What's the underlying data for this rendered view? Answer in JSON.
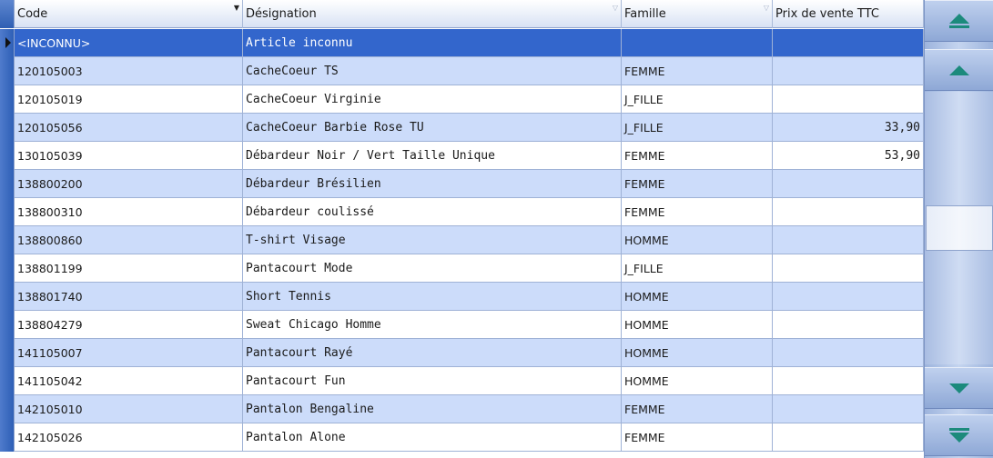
{
  "columns": [
    {
      "label": "Code",
      "key": "code"
    },
    {
      "label": "Désignation",
      "key": "designation"
    },
    {
      "label": "Famille",
      "key": "famille"
    },
    {
      "label": "Prix de vente TTC",
      "key": "prix"
    }
  ],
  "rows": [
    {
      "code": "<INCONNU>",
      "designation": "Article inconnu",
      "famille": "",
      "prix": ""
    },
    {
      "code": "120105003",
      "designation": "CacheCoeur TS",
      "famille": "FEMME",
      "prix": ""
    },
    {
      "code": "120105019",
      "designation": "CacheCoeur Virginie",
      "famille": "J_FILLE",
      "prix": ""
    },
    {
      "code": "120105056",
      "designation": "CacheCoeur Barbie Rose TU",
      "famille": "J_FILLE",
      "prix": "33,90"
    },
    {
      "code": "130105039",
      "designation": "Débardeur Noir / Vert Taille Unique",
      "famille": "FEMME",
      "prix": "53,90"
    },
    {
      "code": "138800200",
      "designation": "Débardeur Brésilien",
      "famille": "FEMME",
      "prix": ""
    },
    {
      "code": "138800310",
      "designation": "Débardeur coulissé",
      "famille": "FEMME",
      "prix": ""
    },
    {
      "code": "138800860",
      "designation": "T-shirt Visage",
      "famille": "HOMME",
      "prix": ""
    },
    {
      "code": "138801199",
      "designation": "Pantacourt Mode",
      "famille": "J_FILLE",
      "prix": ""
    },
    {
      "code": "138801740",
      "designation": "Short Tennis",
      "famille": "HOMME",
      "prix": ""
    },
    {
      "code": "138804279",
      "designation": "Sweat Chicago Homme",
      "famille": "HOMME",
      "prix": ""
    },
    {
      "code": "141105007",
      "designation": "Pantacourt Rayé",
      "famille": "HOMME",
      "prix": ""
    },
    {
      "code": "141105042",
      "designation": "Pantacourt Fun",
      "famille": "HOMME",
      "prix": ""
    },
    {
      "code": "142105010",
      "designation": "Pantalon Bengaline",
      "famille": "FEMME",
      "prix": ""
    },
    {
      "code": "142105026",
      "designation": "Pantalon Alone",
      "famille": "FEMME",
      "prix": ""
    }
  ],
  "selected_row": 0,
  "colors": {
    "selected": "#3366cc",
    "row_alt": "#ccdcfa",
    "arrow": "#1c8a7c"
  },
  "icons": {
    "sort": "sort-desc-icon",
    "filter": "filter-icon",
    "row_pointer": "row-pointer-icon",
    "first": "double-chevron-up-icon",
    "prev": "chevron-up-icon",
    "next": "chevron-down-icon",
    "last": "double-chevron-down-icon"
  }
}
